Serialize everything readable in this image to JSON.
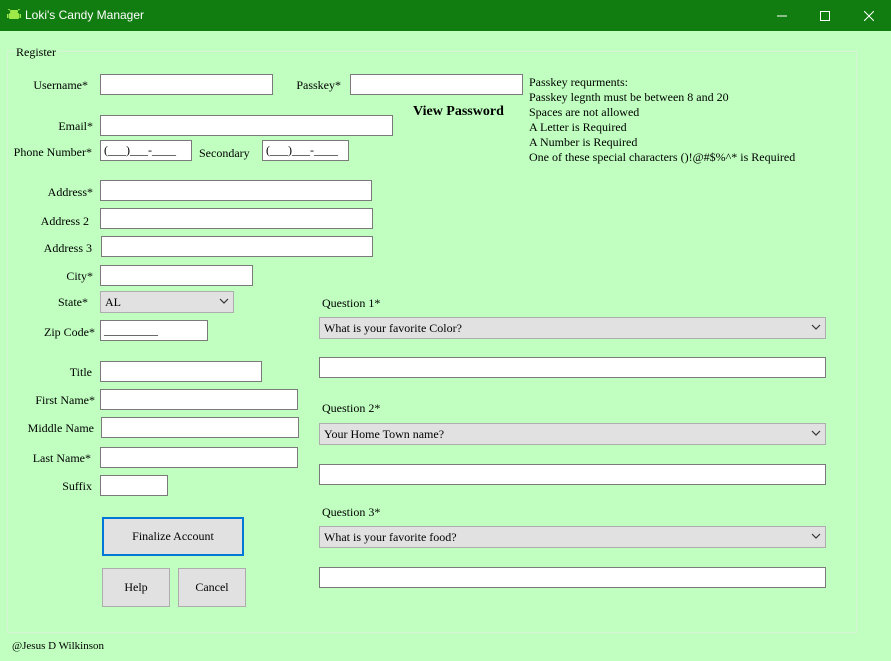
{
  "window": {
    "title": "Loki's Candy Manager",
    "icon": "android-icon",
    "minimize_icon": "minimize-icon",
    "maximize_icon": "maximize-icon",
    "close_icon": "close-icon",
    "titlebar_color": "#117d11",
    "background_color": "#c0ffc0"
  },
  "form": {
    "group_title": "Register",
    "username_label": "Username*",
    "username_value": "",
    "passkey_label": "Passkey*",
    "passkey_value": "",
    "view_password": "View Password",
    "requirements": [
      "Passkey requrments:",
      "Passkey legnth must be between 8 and 20",
      "Spaces are not allowed",
      "A Letter is Required",
      "A Number is Required",
      "One of these special characters ()!@#$%^* is Required"
    ],
    "email_label": "Email*",
    "email_value": "",
    "phone_label": "Phone Number*",
    "phone_mask": "(___)___-____",
    "secondary_label": "Secondary",
    "secondary_mask": "(___)___-____",
    "address1_label": "Address*",
    "address2_label": "Address 2",
    "address3_label": "Address 3",
    "city_label": "City*",
    "state_label": "State*",
    "state_value": "AL",
    "zip_label": "Zip Code*",
    "zip_mask": "_________",
    "title_label": "Title",
    "first_name_label": "First Name*",
    "middle_name_label": "Middle Name",
    "last_name_label": "Last Name*",
    "suffix_label": "Suffix"
  },
  "questions": [
    {
      "label": "Question 1*",
      "selected": "What is your favorite Color?",
      "answer": ""
    },
    {
      "label": "Question 2*",
      "selected": "Your Home Town name?",
      "answer": ""
    },
    {
      "label": "Question 3*",
      "selected": "What is your favorite food?",
      "answer": ""
    }
  ],
  "buttons": {
    "finalize": "Finalize Account",
    "help": "Help",
    "cancel": "Cancel"
  },
  "footer": {
    "credit": "@Jesus D Wilkinson"
  }
}
